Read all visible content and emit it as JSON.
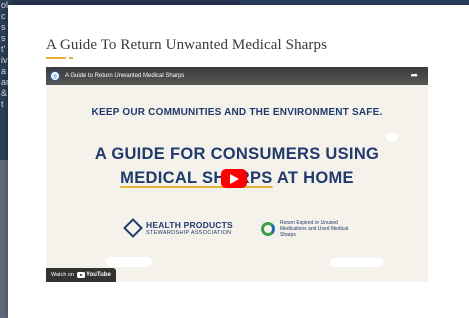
{
  "background_page": {
    "left_fragments": [
      "ol",
      "c",
      "s",
      "s",
      "t'",
      "iv",
      "a",
      "ar",
      "&",
      "t"
    ]
  },
  "modal": {
    "title": "A Guide To Return Unwanted Medical Sharps"
  },
  "video": {
    "channel_avatar_glyph": "◎",
    "title": "A Guide to Return Unwanted Medical Sharps",
    "share_icon": "share-icon",
    "tagline": "KEEP OUR COMMUNITIES AND THE ENVIRONMENT SAFE.",
    "headline_line1": "A GUIDE FOR CONSUMERS USING",
    "headline_emphasis": "MEDICAL SHARPS",
    "headline_rest": " AT HOME",
    "org1_name": "HEALTH PRODUCTS",
    "org1_sub": "STEWARDSHIP ASSOCIATION",
    "org2_text": "Return Expired or Unused Medications and Used Medical Sharps",
    "watch_on_label": "Watch on",
    "youtube_label": "YouTube",
    "play_button_color": "#ff0000",
    "brand_color": "#1f3a6b",
    "accent_color": "#e8b23a"
  }
}
